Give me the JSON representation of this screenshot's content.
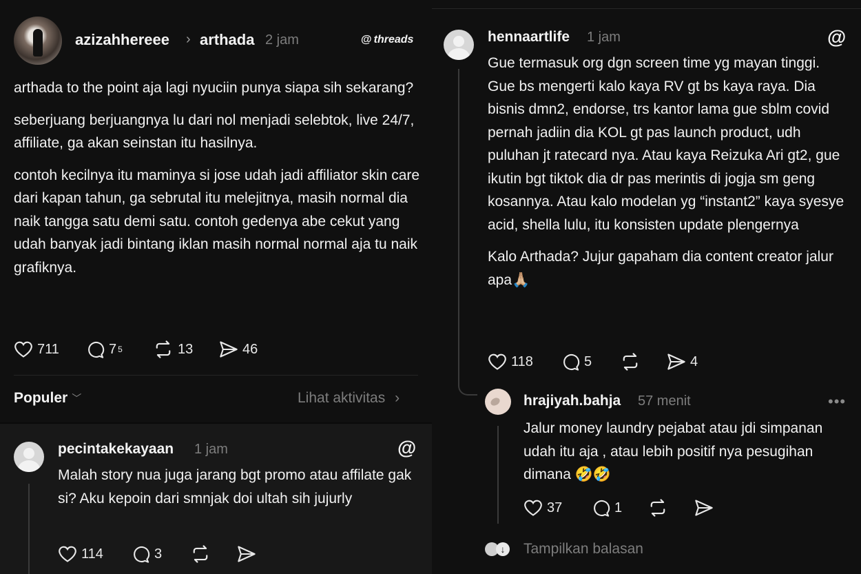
{
  "main_post": {
    "author": "azizahhereee",
    "reply_to": "arthada",
    "time": "2 jam",
    "brand": "threads",
    "paragraphs": [
      "arthada to the point aja lagi nyuciin punya siapa sih sekarang?",
      "seberjuang berjuangnya lu dari nol menjadi selebtok, live 24/7, affiliate, ga akan seinstan itu hasilnya.",
      "contoh kecilnya itu maminya si jose udah jadi affiliator skin care dari kapan tahun, ga sebrutal itu melejitnya, masih normal dia naik tangga satu demi satu. contoh gedenya abe cekut yang udah banyak jadi bintang iklan masih normal normal aja tu naik grafiknya."
    ],
    "likes": "711",
    "replies": "7",
    "replies_sup": "5",
    "reposts": "13",
    "shares": "46"
  },
  "sort_bar": {
    "label": "Populer",
    "activity": "Lihat aktivitas"
  },
  "reply1": {
    "author": "pecintakekayaan",
    "time": "1 jam",
    "text": "Malah story nua juga jarang bgt promo atau affilate gak si? Aku kepoin dari smnjak doi ultah sih jujurly",
    "likes": "114",
    "replies": "3"
  },
  "reply2": {
    "author": "hennaartlife",
    "time": "1 jam",
    "paragraphs": [
      "Gue termasuk org dgn screen time yg mayan tinggi. Gue bs mengerti kalo kaya RV gt bs kaya raya. Dia bisnis dmn2, endorse, trs kantor lama gue sblm covid pernah jadiin dia KOL gt pas launch product, udh puluhan jt ratecard nya. Atau kaya Reizuka Ari gt2, gue ikutin bgt tiktok dia dr pas merintis di jogja sm geng kosannya. Atau kalo modelan yg “instant2” kaya syesye acid, shella lulu, itu konsisten update plengernya",
      "Kalo Arthada? Jujur gapaham dia content creator jalur apa🙏🏼"
    ],
    "likes": "118",
    "replies": "5",
    "shares": "4"
  },
  "reply3": {
    "author": "hrajiyah.bahja",
    "time": "57 menit",
    "text": "Jalur money laundry pejabat atau jdi simpanan udah itu aja , atau lebih positif nya pesugihan dimana 🤣🤣",
    "likes": "37",
    "replies": "1",
    "more": "•••"
  },
  "show_replies": {
    "label": "Tampilkan balasan"
  },
  "icons": {
    "like": "heart-icon",
    "reply": "comment-icon",
    "repost": "repost-icon",
    "share": "send-icon",
    "threads": "threads-logo-icon"
  }
}
